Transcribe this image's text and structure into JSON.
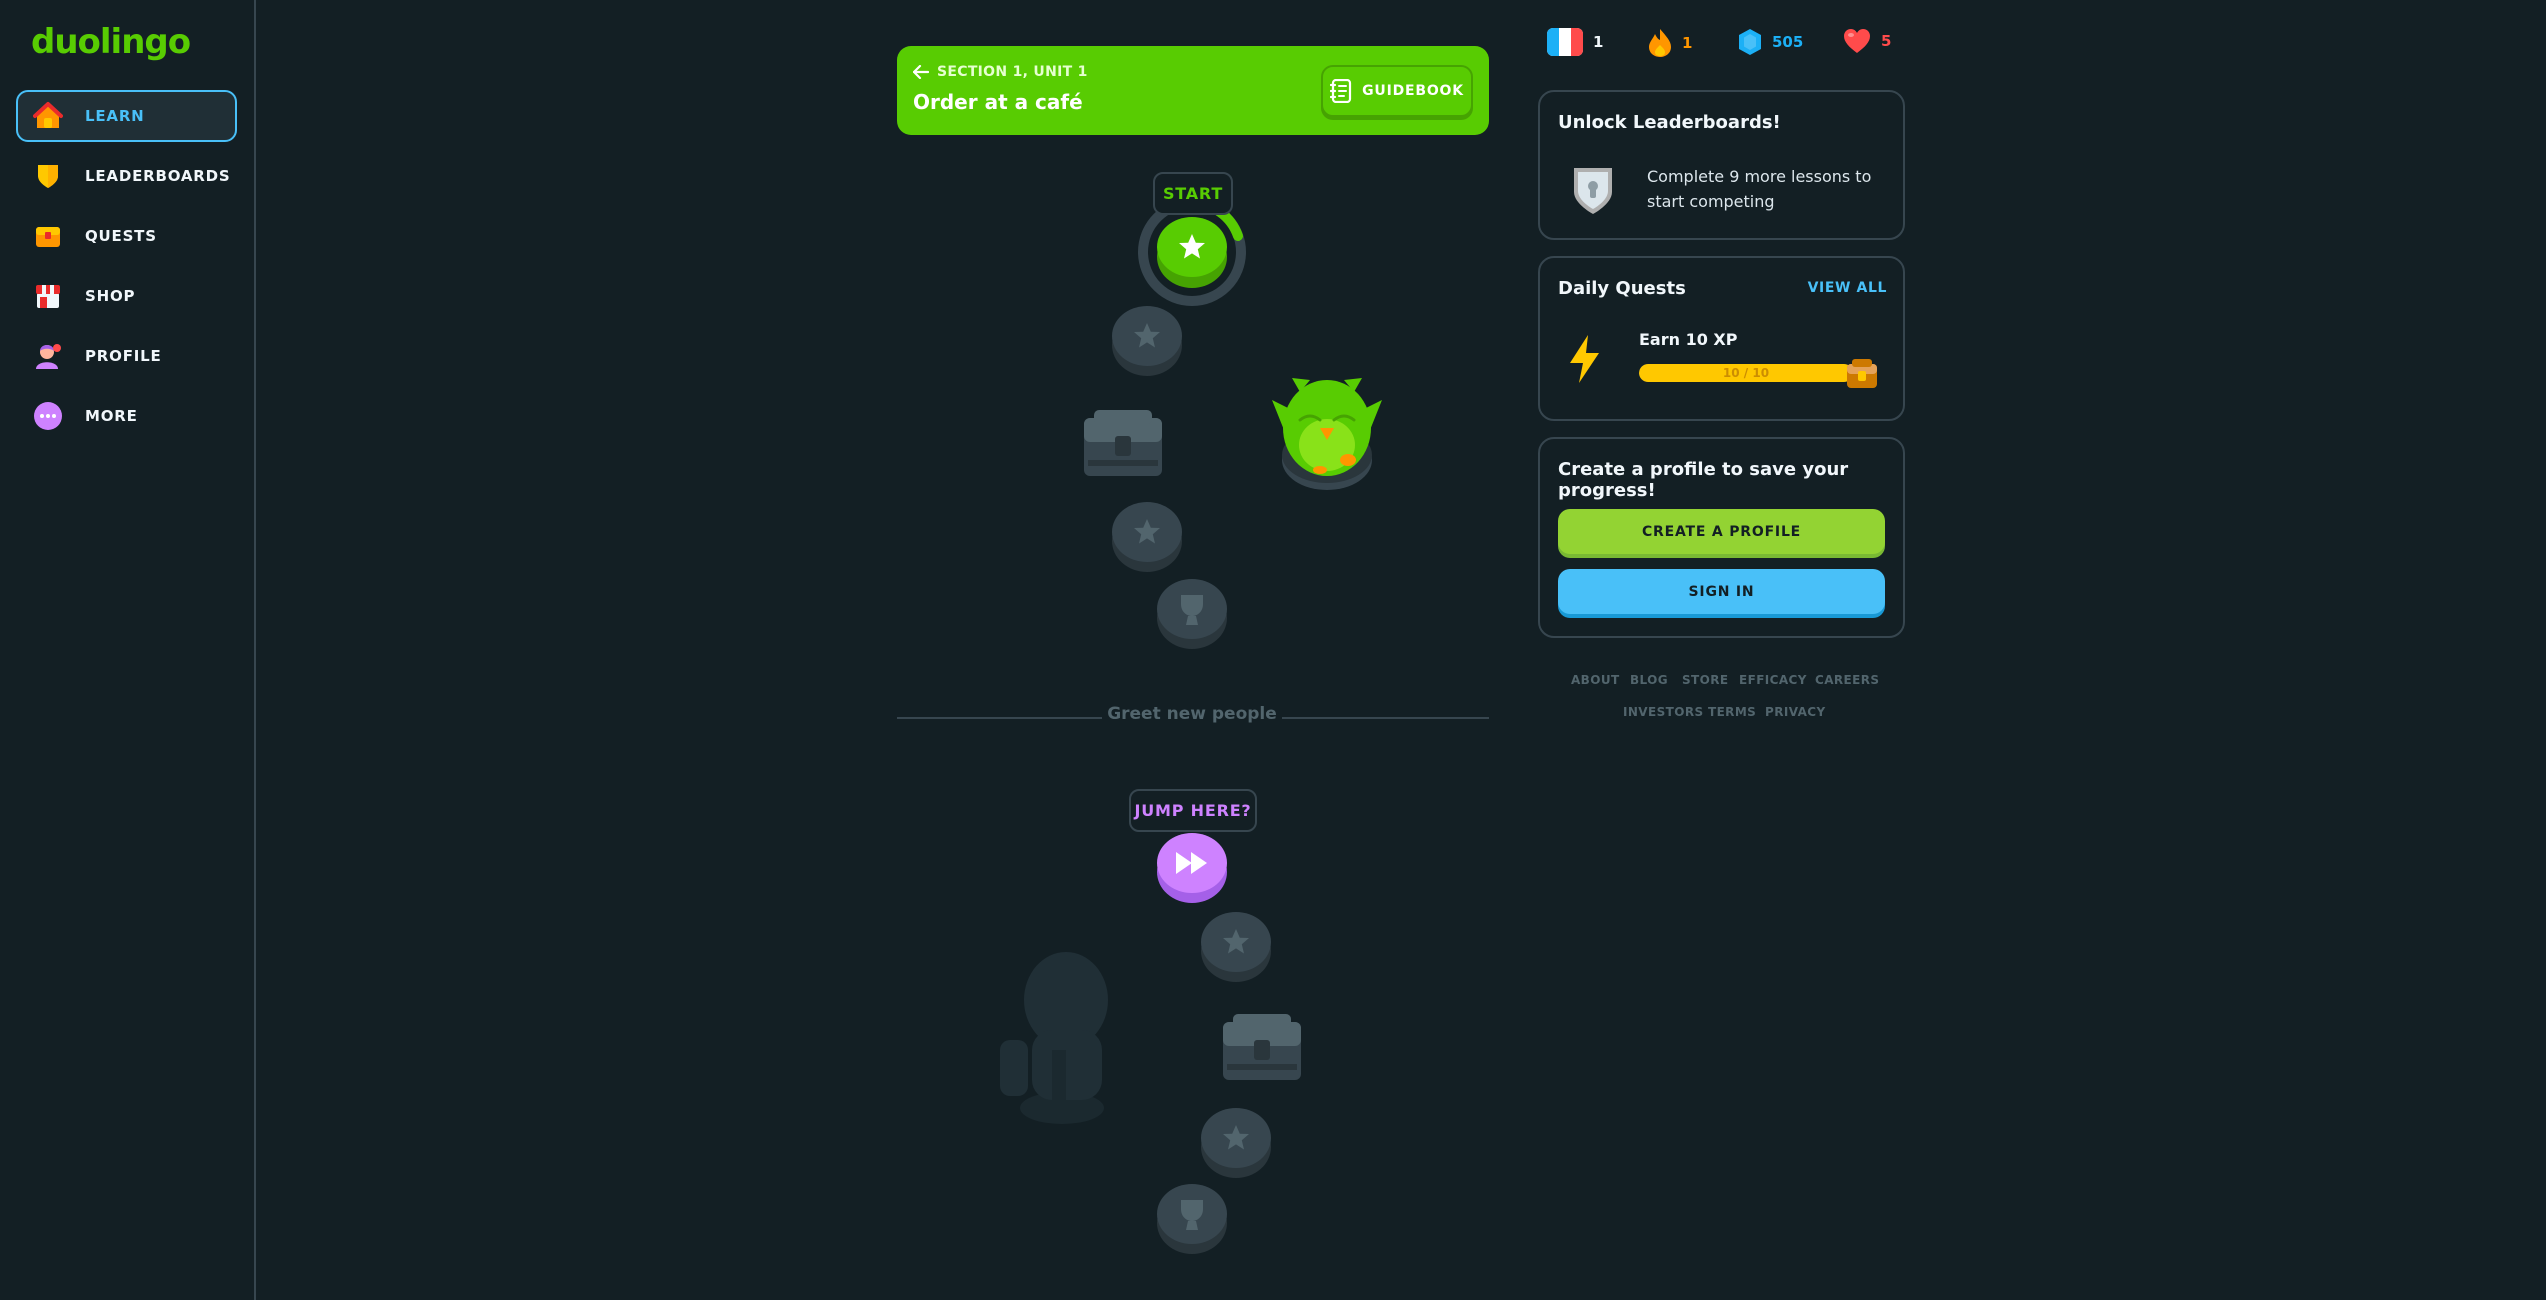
{
  "app": {
    "logo": "duolingo"
  },
  "sidebar": {
    "items": [
      {
        "label": "LEARN",
        "icon": "home-icon",
        "active": true
      },
      {
        "label": "LEADERBOARDS",
        "icon": "shield-icon"
      },
      {
        "label": "QUESTS",
        "icon": "treasure-chest-icon"
      },
      {
        "label": "SHOP",
        "icon": "shop-icon"
      },
      {
        "label": "PROFILE",
        "icon": "profile-avatar-icon"
      },
      {
        "label": "MORE",
        "icon": "more-dots-icon"
      }
    ]
  },
  "unit": {
    "section": "SECTION 1, UNIT 1",
    "title": "Order at a café",
    "guidebook_label": "GUIDEBOOK"
  },
  "path": {
    "start_label": "START",
    "divider_text": "Greet new people",
    "jump_label": "JUMP HERE?"
  },
  "stats": {
    "language": "1",
    "streak": "1",
    "gems": "505",
    "hearts": "5"
  },
  "leaderboard_card": {
    "title": "Unlock Leaderboards!",
    "text": "Complete 9 more lessons to start competing"
  },
  "quests_card": {
    "title": "Daily Quests",
    "view_all": "VIEW ALL",
    "quest_name": "Earn 10 XP",
    "progress_text": "10 / 10",
    "progress_fraction": 1.0
  },
  "profile_card": {
    "title": "Create a profile to save your progress!",
    "create_label": "CREATE A PROFILE",
    "signin_label": "SIGN IN"
  },
  "footer": {
    "row1": [
      "ABOUT",
      "BLOG",
      "STORE",
      "EFFICACY",
      "CAREERS"
    ],
    "row2": [
      "INVESTORS",
      "TERMS",
      "PRIVACY"
    ]
  },
  "colors": {
    "background": "#131f24",
    "brand_green": "#58cc02",
    "accent_blue": "#49c0f8",
    "border": "#37464f",
    "jump_purple": "#ce82ff",
    "gem_blue": "#1cb0f6",
    "heart_red": "#ff4b4b",
    "streak_orange": "#ff9600"
  }
}
